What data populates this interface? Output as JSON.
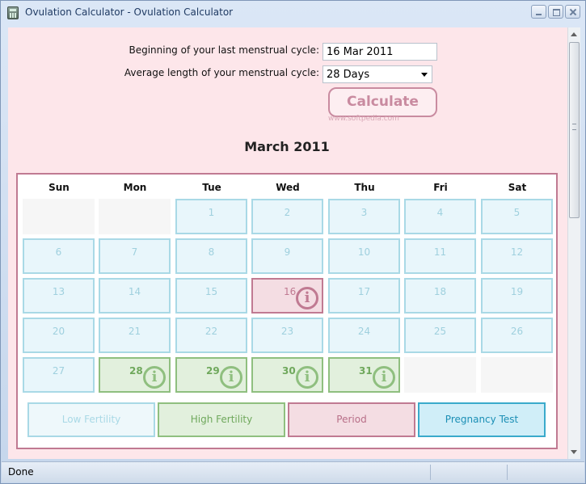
{
  "window": {
    "title": "Ovulation Calculator - Ovulation Calculator"
  },
  "form": {
    "start_label": "Beginning of your last menstrual cycle:",
    "start_value": "16 Mar 2011",
    "length_label": "Average length of your menstrual cycle:",
    "length_value": "28 Days",
    "calculate_label": "Calculate",
    "watermark": "www.softpedia.com"
  },
  "calendar": {
    "month_title": "March 2011",
    "weekdays": [
      "Sun",
      "Mon",
      "Tue",
      "Wed",
      "Thu",
      "Fri",
      "Sat"
    ],
    "first_weekday_index": 2,
    "days_in_month": 31,
    "period_days": [
      16
    ],
    "high_fertility_days": [
      28,
      29,
      30,
      31
    ],
    "info_icon": "i",
    "colors": {
      "low": "#a9d9e6",
      "high": "#8fbf7f",
      "period": "#c07a92",
      "pregnancy": "#3aaacb"
    }
  },
  "legend": {
    "low": "Low Fertility",
    "high": "High Fertility",
    "period": "Period",
    "pregnancy": "Pregnancy Test"
  },
  "status": {
    "text": "Done"
  }
}
